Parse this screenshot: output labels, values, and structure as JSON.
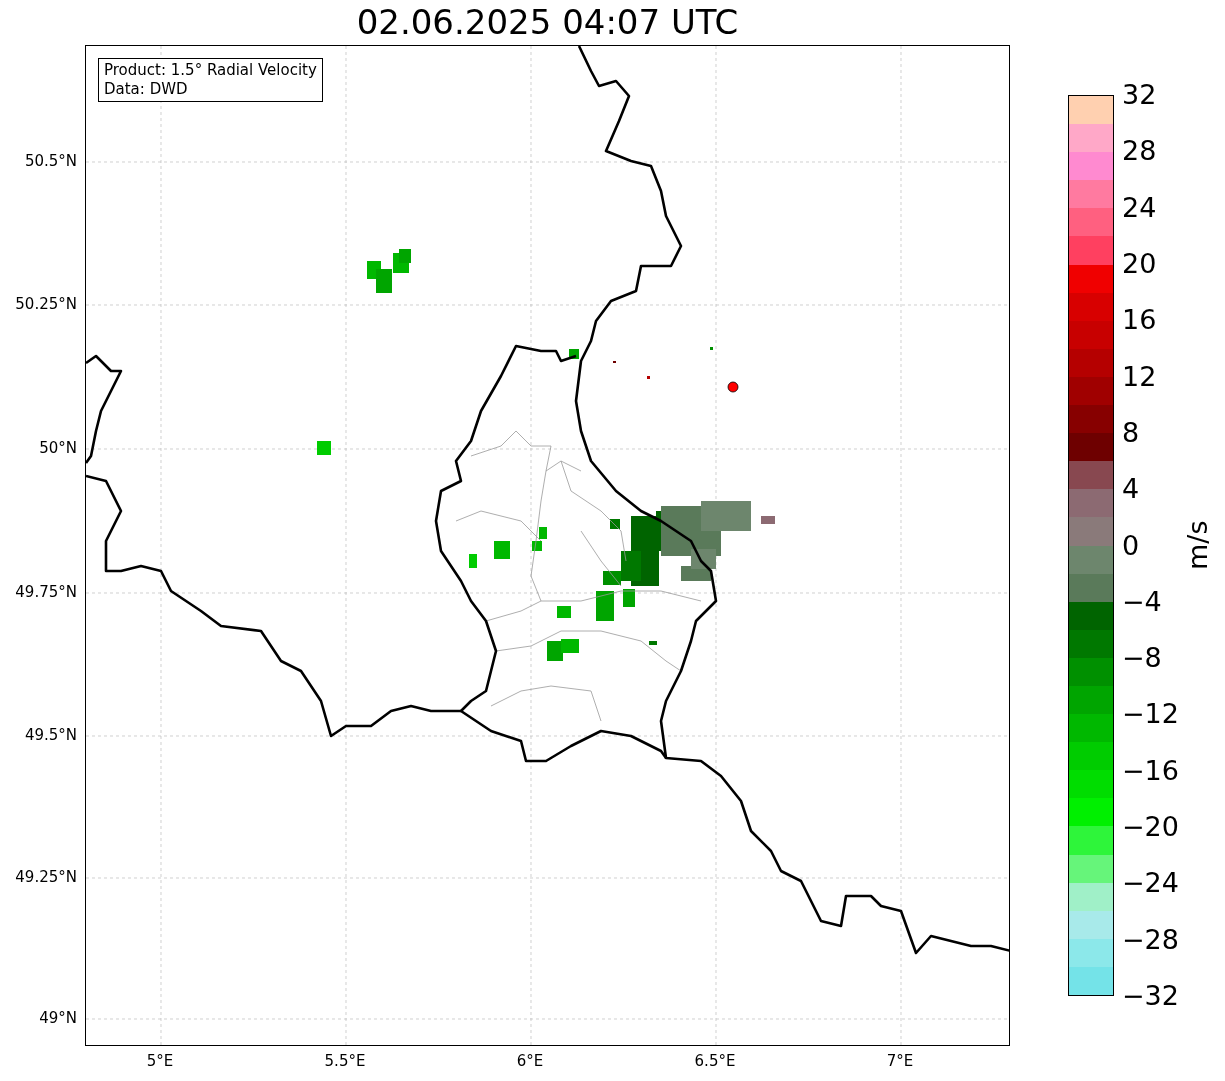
{
  "title": "02.06.2025 04:07 UTC",
  "info_box": {
    "lines": [
      "Product: 1.5° Radial Velocity",
      "Data: DWD"
    ]
  },
  "map": {
    "lat_ticks": [
      "50.5°N",
      "50.25°N",
      "50°N",
      "49.75°N",
      "49.5°N",
      "49.25°N",
      "49°N"
    ],
    "lon_ticks": [
      "5°E",
      "5.5°E",
      "6°E",
      "6.5°E",
      "7°E"
    ]
  },
  "colorbar": {
    "label": "m/s",
    "ticks": [
      "32",
      "28",
      "24",
      "20",
      "16",
      "12",
      "8",
      "4",
      "0",
      "−4",
      "−8",
      "−12",
      "−16",
      "−20",
      "−24",
      "−28",
      "−32"
    ],
    "bands": [
      {
        "color": "#ffd0b0"
      },
      {
        "color": "#ffa8c8"
      },
      {
        "color": "#ff8ad0"
      },
      {
        "color": "#ff7aa0"
      },
      {
        "color": "#ff6080"
      },
      {
        "color": "#ff4060"
      },
      {
        "color": "#f00000"
      },
      {
        "color": "#d80000"
      },
      {
        "color": "#c80000"
      },
      {
        "color": "#b50000"
      },
      {
        "color": "#a00000"
      },
      {
        "color": "#870000"
      },
      {
        "color": "#6e0000"
      },
      {
        "color": "#884850"
      },
      {
        "color": "#8c6a72"
      },
      {
        "color": "#8a7a7a"
      },
      {
        "color": "#6d866d"
      },
      {
        "color": "#5a7a5a"
      },
      {
        "color": "#006400"
      },
      {
        "color": "#007800"
      },
      {
        "color": "#009000"
      },
      {
        "color": "#00a500"
      },
      {
        "color": "#00b800"
      },
      {
        "color": "#00cc00"
      },
      {
        "color": "#00dd00"
      },
      {
        "color": "#00f000"
      },
      {
        "color": "#2ef53a"
      },
      {
        "color": "#66f57a"
      },
      {
        "color": "#a0f0c8"
      },
      {
        "color": "#a8eaea"
      },
      {
        "color": "#8ce8ea"
      },
      {
        "color": "#74e3e8"
      }
    ]
  }
}
